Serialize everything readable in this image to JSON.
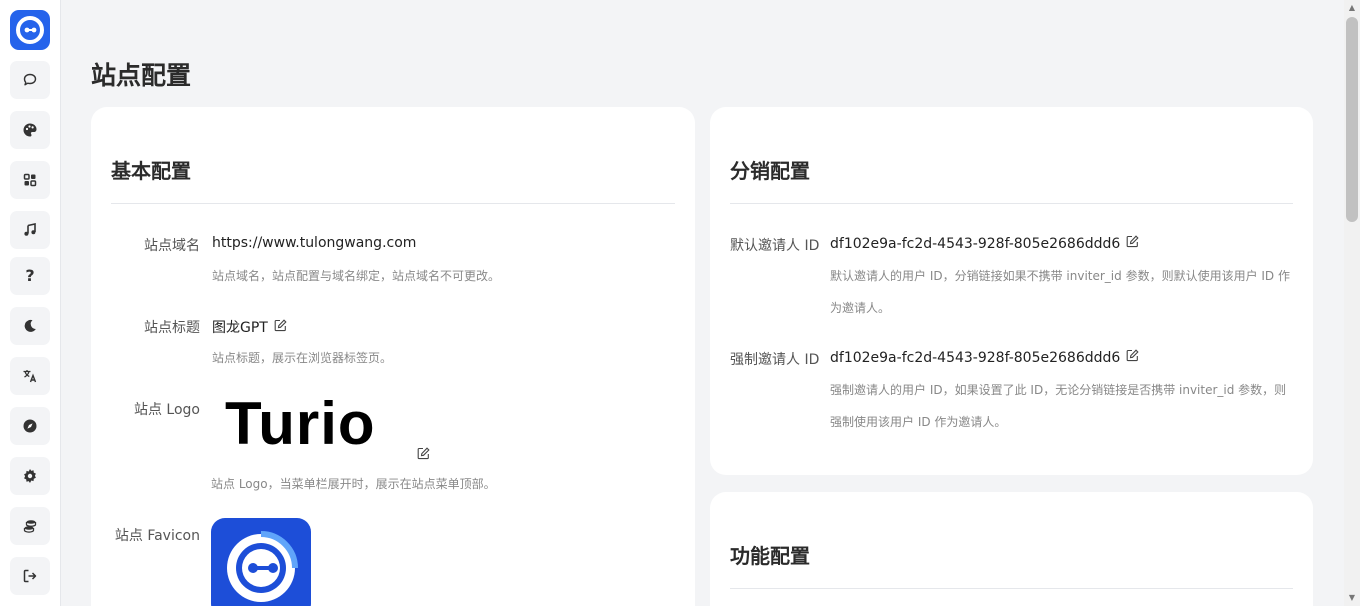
{
  "page": {
    "title": "站点配置"
  },
  "sidebar": {
    "items": [
      {
        "icon": "chat-bubble-icon"
      },
      {
        "icon": "palette-icon"
      },
      {
        "icon": "apps-grid-icon"
      },
      {
        "icon": "music-note-icon"
      },
      {
        "icon": "help-icon",
        "glyph": "?"
      },
      {
        "icon": "moon-icon"
      },
      {
        "icon": "translate-icon"
      },
      {
        "icon": "compass-icon"
      },
      {
        "icon": "settings-gear-icon"
      },
      {
        "icon": "coins-icon"
      },
      {
        "icon": "logout-icon"
      }
    ]
  },
  "basic": {
    "title": "基本配置",
    "domain": {
      "label": "站点域名",
      "value": "https://www.tulongwang.com",
      "help": "站点域名，站点配置与域名绑定，站点域名不可更改。"
    },
    "site_title": {
      "label": "站点标题",
      "value": "图龙GPT",
      "help": "站点标题，展示在浏览器标签页。"
    },
    "logo": {
      "label": "站点 Logo",
      "image_text": "Turio",
      "help": "站点 Logo，当菜单栏展开时，展示在站点菜单顶部。"
    },
    "favicon": {
      "label": "站点 Favicon"
    }
  },
  "distribution": {
    "title": "分销配置",
    "default_inviter": {
      "label": "默认邀请人 ID",
      "value": "df102e9a-fc2d-4543-928f-805e2686ddd6",
      "help_line1": "默认邀请人的用户 ID，分销链接如果不携带 inviter_id 参数，则默认使用该用户 ID 作",
      "help_line2": "为邀请人。"
    },
    "forced_inviter": {
      "label": "强制邀请人 ID",
      "value": "df102e9a-fc2d-4543-928f-805e2686ddd6",
      "help_line1": "强制邀请人的用户 ID，如果设置了此 ID，无论分销链接是否携带 inviter_id 参数，则",
      "help_line2": "强制使用该用户 ID 作为邀请人。"
    }
  },
  "features": {
    "title": "功能配置"
  },
  "colors": {
    "brand": "#2563eb",
    "background": "#f3f4f6",
    "card": "#ffffff",
    "help_text": "#888888"
  }
}
